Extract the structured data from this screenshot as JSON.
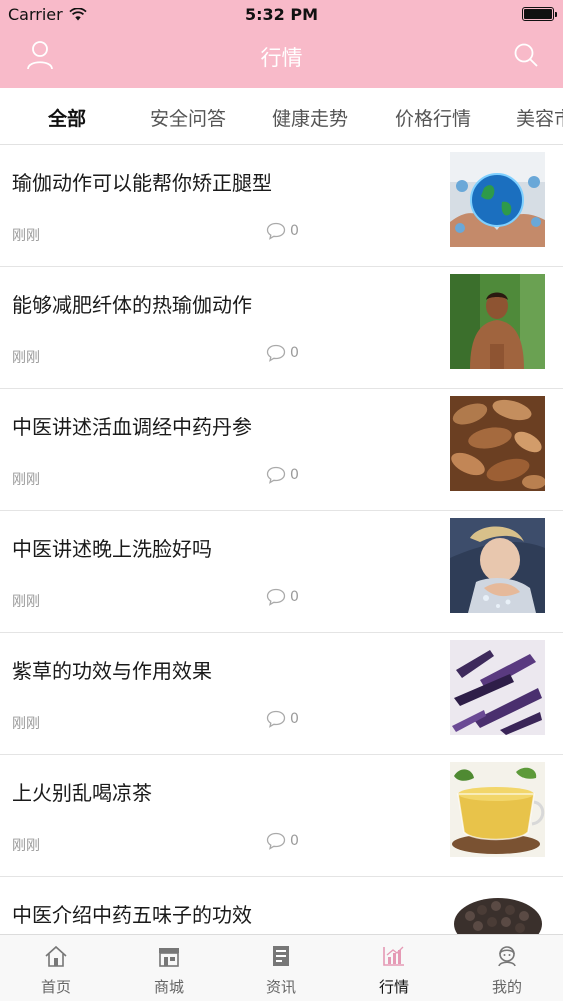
{
  "status_bar": {
    "carrier": "Carrier",
    "time": "5:32 PM"
  },
  "header": {
    "title": "行情",
    "accent_color": "#f8bac9"
  },
  "tabs": [
    {
      "label": "全部",
      "active": true
    },
    {
      "label": "安全问答",
      "active": false
    },
    {
      "label": "健康走势",
      "active": false
    },
    {
      "label": "价格行情",
      "active": false
    },
    {
      "label": "美容市",
      "active": false
    }
  ],
  "articles": [
    {
      "title": "瑜伽动作可以能帮你矫正腿型",
      "time": "刚刚",
      "comments": "0",
      "thumb": "globe-in-hands-image"
    },
    {
      "title": "能够减肥纤体的热瑜伽动作",
      "time": "刚刚",
      "comments": "0",
      "thumb": "shirtless-man-image"
    },
    {
      "title": "中医讲述活血调经中药丹参",
      "time": "刚刚",
      "comments": "0",
      "thumb": "dried-danshen-root-image"
    },
    {
      "title": "中医讲述晚上洗脸好吗",
      "time": "刚刚",
      "comments": "0",
      "thumb": "woman-washing-face-image"
    },
    {
      "title": "紫草的功效与作用效果",
      "time": "刚刚",
      "comments": "0",
      "thumb": "purple-gromwell-herb-image"
    },
    {
      "title": "上火别乱喝凉茶",
      "time": "刚刚",
      "comments": "0",
      "thumb": "herbal-tea-cup-image"
    },
    {
      "title": "中医介绍中药五味子的功效",
      "time": "",
      "comments": "",
      "thumb": "schisandra-berries-image"
    }
  ],
  "tabbar": [
    {
      "label": "首页",
      "icon": "home-icon",
      "active": false
    },
    {
      "label": "商城",
      "icon": "store-icon",
      "active": false
    },
    {
      "label": "资讯",
      "icon": "news-icon",
      "active": false
    },
    {
      "label": "行情",
      "icon": "chart-icon",
      "active": true
    },
    {
      "label": "我的",
      "icon": "profile-icon",
      "active": false
    }
  ]
}
